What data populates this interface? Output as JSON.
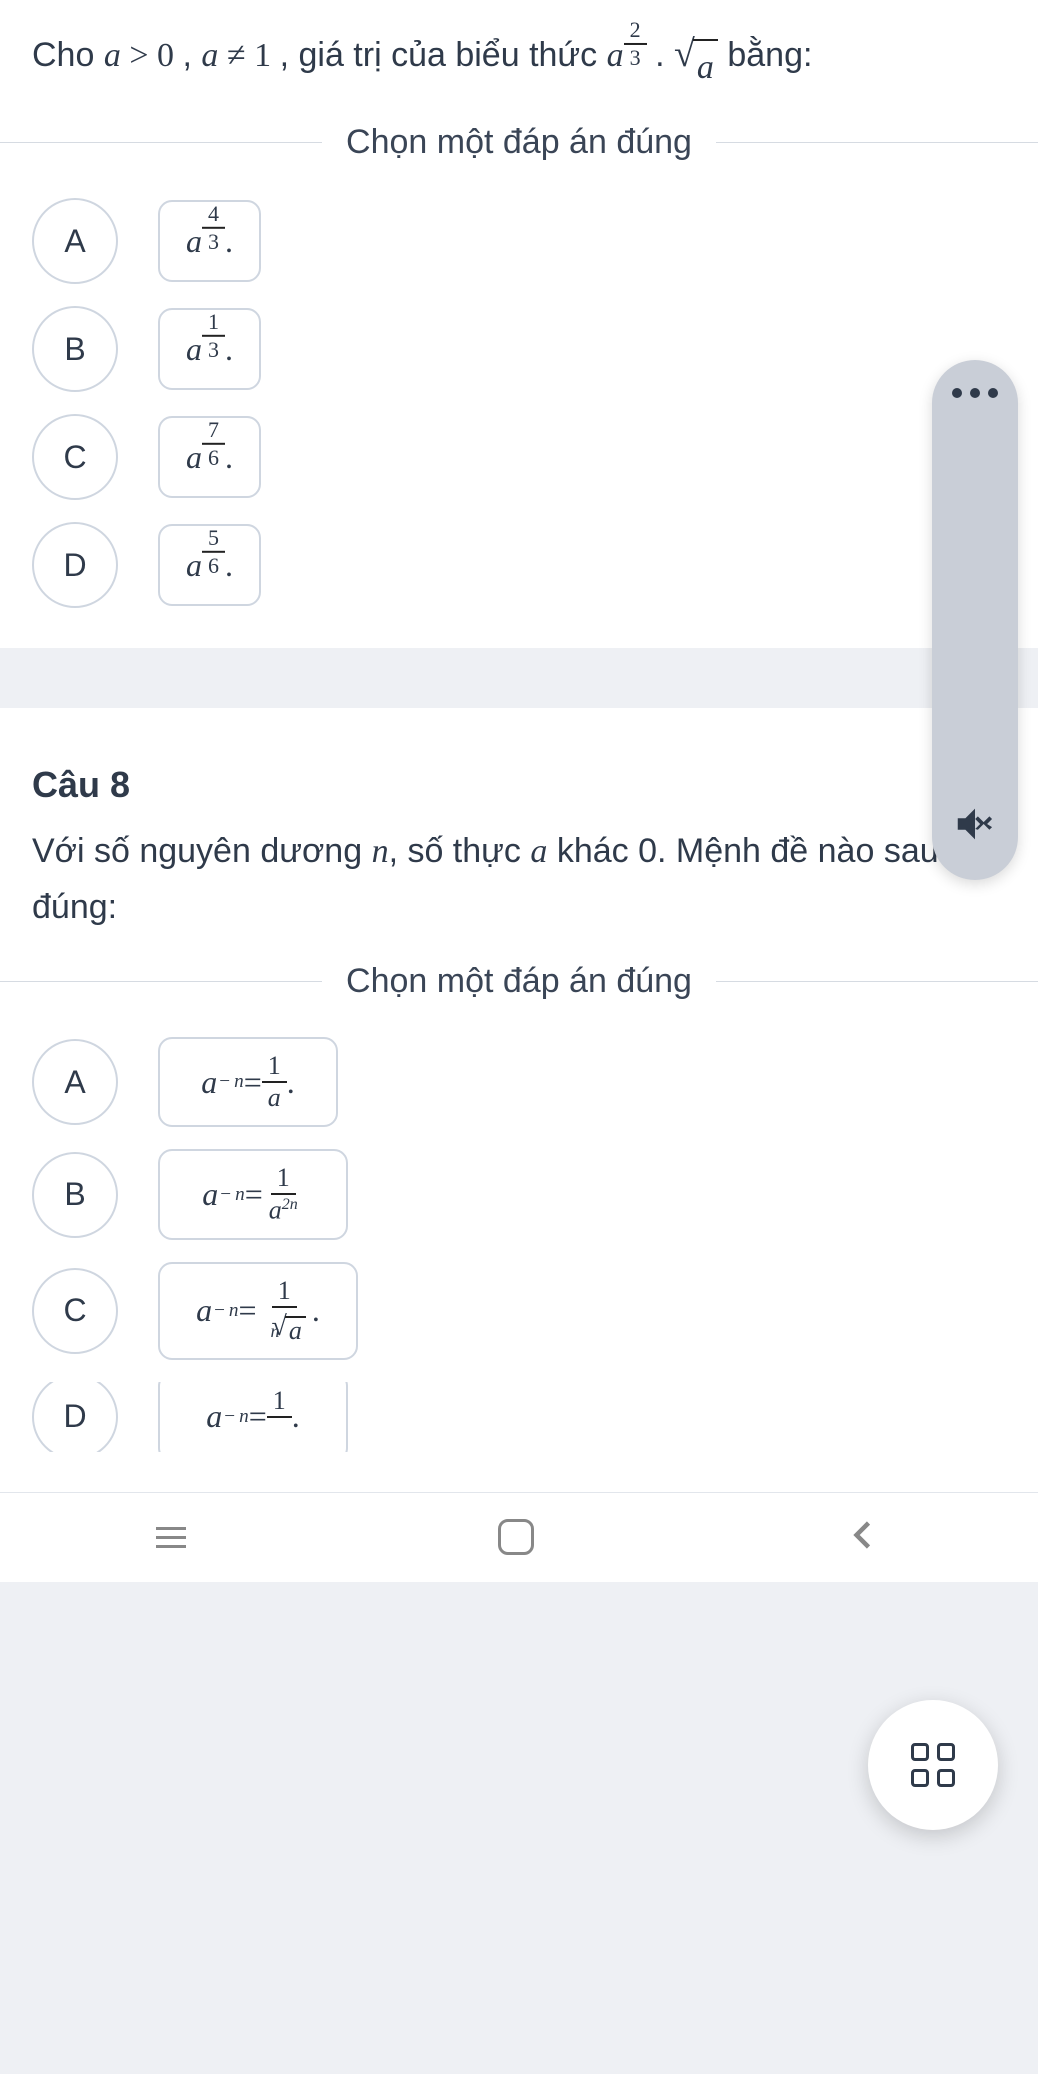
{
  "question7": {
    "prompt_prefix": "Cho ",
    "cond1_base": "a",
    "cond1_op": ">",
    "cond1_rhs": "0",
    "sep1": ", ",
    "cond2_base": "a",
    "cond2_op": "≠",
    "cond2_rhs": "1",
    "prompt_mid": ", giá trị của biểu thức ",
    "expr_base": "a",
    "expr_exp_num": "2",
    "expr_exp_den": "3",
    "dot": " . ",
    "root_radicand": "a",
    "prompt_suffix": " bằng:",
    "instruction": "Chọn một đáp án đúng",
    "options": [
      {
        "label": "A",
        "base": "a",
        "num": "4",
        "den": "3",
        "trail": " ."
      },
      {
        "label": "B",
        "base": "a",
        "num": "1",
        "den": "3",
        "trail": " ."
      },
      {
        "label": "C",
        "base": "a",
        "num": "7",
        "den": "6",
        "trail": " ."
      },
      {
        "label": "D",
        "base": "a",
        "num": "5",
        "den": "6",
        "trail": " ."
      }
    ]
  },
  "question8": {
    "title": "Câu 8",
    "prompt_p1": "Với số nguyên dương ",
    "var_n": "n",
    "prompt_p2": ", số thực ",
    "var_a": "a",
    "prompt_p3": " khác 0. Mệnh đề nào sau đây đúng:",
    "instruction": "Chọn một đáp án đúng",
    "lhs_base": "a",
    "lhs_exp_neg": "−",
    "lhs_exp_var": "n",
    "eq": " = ",
    "options": [
      {
        "label": "A",
        "rhs_type": "frac_simple",
        "num": "1",
        "den_text": "a",
        "trail": "."
      },
      {
        "label": "B",
        "rhs_type": "frac_pow",
        "num": "1",
        "den_base": "a",
        "den_exp": "2n",
        "trail": ""
      },
      {
        "label": "C",
        "rhs_type": "frac_root",
        "num": "1",
        "root_index": "n",
        "radicand": "a",
        "trail": "."
      },
      {
        "label": "D",
        "rhs_type": "frac_partial",
        "num": "1",
        "trail": "."
      }
    ]
  },
  "icons": {
    "more": "more-icon",
    "mute": "mute-icon",
    "grid": "grid-icon"
  }
}
